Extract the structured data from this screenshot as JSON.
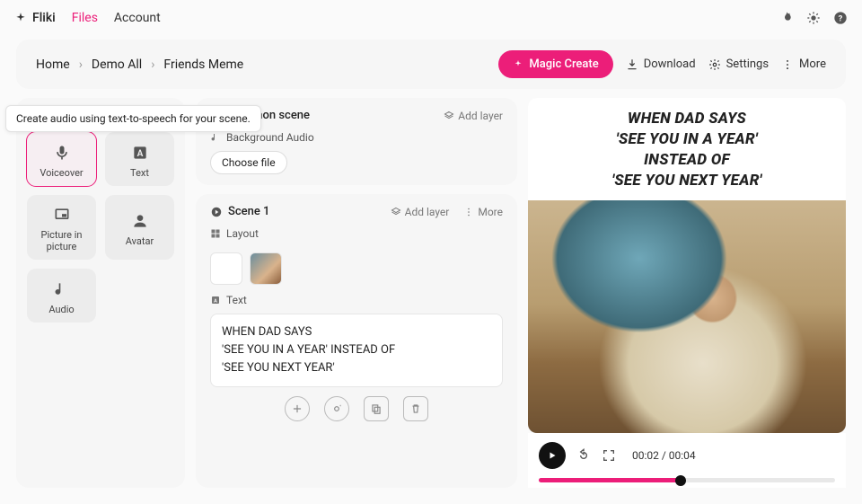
{
  "brand": "Fliki",
  "nav": {
    "files": "Files",
    "account": "Account"
  },
  "breadcrumbs": [
    "Home",
    "Demo All",
    "Friends Meme"
  ],
  "actions": {
    "magic": "Magic Create",
    "download": "Download",
    "settings": "Settings",
    "more": "More"
  },
  "tooltip": "Create audio using text-to-speech for your scene.",
  "tools": {
    "voiceover": "Voiceover",
    "text": "Text",
    "pip": "Picture in picture",
    "avatar": "Avatar",
    "audio": "Audio"
  },
  "common": {
    "title": "Common scene",
    "addlayer": "Add layer",
    "bgaudio": "Background Audio",
    "choose": "Choose file"
  },
  "scene": {
    "title": "Scene 1",
    "addlayer": "Add layer",
    "more": "More",
    "layout": "Layout",
    "textlabel": "Text",
    "text": "WHEN DAD SAYS\n'SEE YOU IN A YEAR' INSTEAD OF\n'SEE YOU NEXT YEAR'"
  },
  "preview": {
    "text": "WHEN DAD SAYS\n'SEE YOU IN A YEAR'\nINSTEAD OF\n'SEE YOU NEXT YEAR'"
  },
  "player": {
    "time": "00:02 / 00:04",
    "progress_pct": 48
  }
}
